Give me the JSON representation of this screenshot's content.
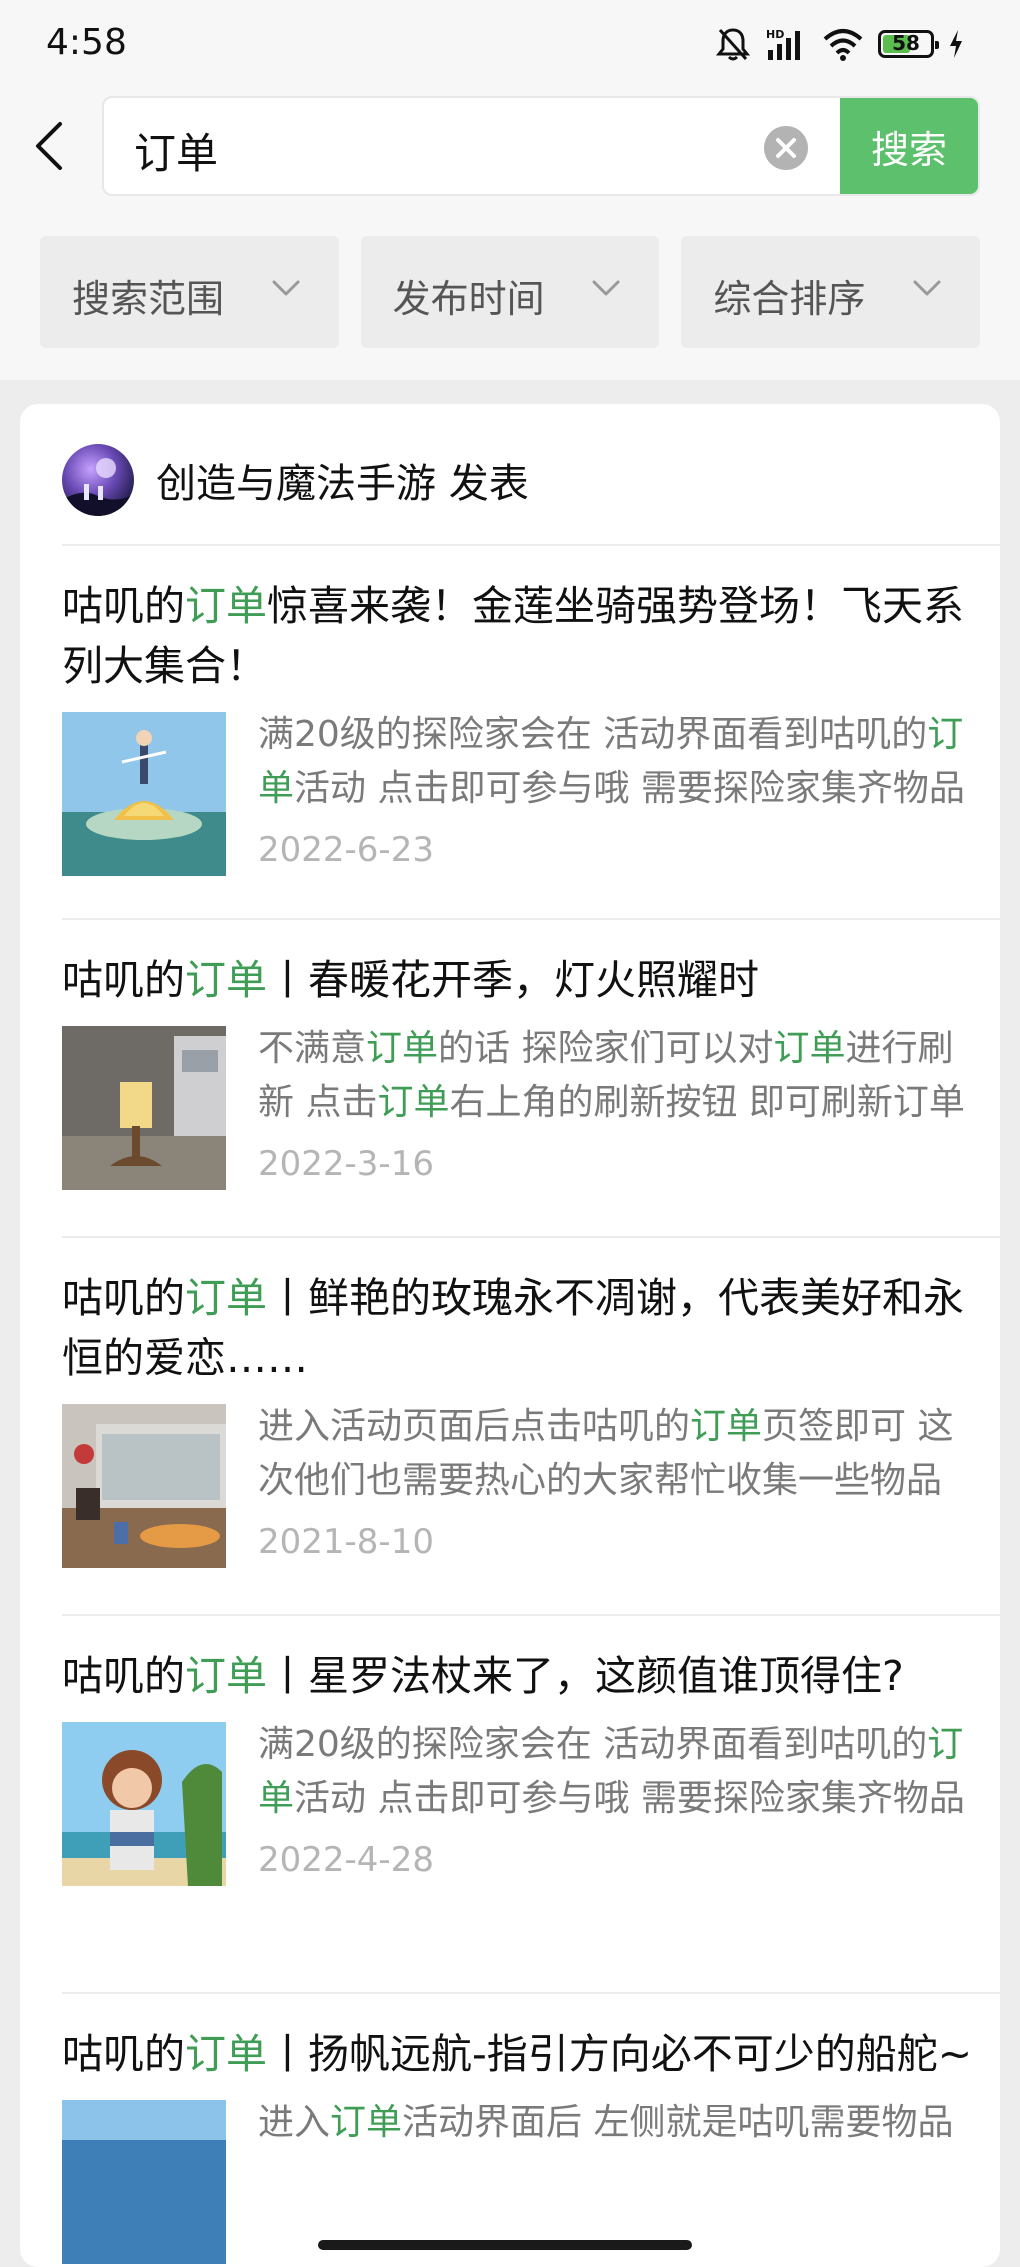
{
  "status_bar": {
    "time": "4:58",
    "battery": "58",
    "battery_level": 0.58
  },
  "search": {
    "query": "订单",
    "button_label": "搜索"
  },
  "filters": [
    {
      "label": "搜索范围"
    },
    {
      "label": "发布时间"
    },
    {
      "label": "综合排序"
    }
  ],
  "author": {
    "name": "创造与魔法手游 发表"
  },
  "results": [
    {
      "title_pre": "咕叽的",
      "title_hl": "订单",
      "title_post": "惊喜来袭！金莲坐骑强势登场！飞天系列大集合！",
      "desc": [
        {
          "t": "满20级的探险家会在 活动界面看到咕叽的"
        },
        {
          "t": "订单",
          "hl": true
        },
        {
          "t": "活动 点击即可参与哦 需要探险家集齐物品"
        }
      ],
      "date": "2022-6-23"
    },
    {
      "title_pre": "咕叽的",
      "title_hl": "订单",
      "title_post": "丨春暖花开季，灯火照耀时",
      "desc": [
        {
          "t": "不满意"
        },
        {
          "t": "订单",
          "hl": true
        },
        {
          "t": "的话 探险家们可以对"
        },
        {
          "t": "订单",
          "hl": true
        },
        {
          "t": "进行刷新 点击"
        },
        {
          "t": "订单",
          "hl": true
        },
        {
          "t": "右上角的刷新按钮 即可刷新订单"
        }
      ],
      "date": "2022-3-16"
    },
    {
      "title_pre": "咕叽的",
      "title_hl": "订单",
      "title_post": "丨鲜艳的玫瑰永不凋谢，代表美好和永恒的爱恋……",
      "desc": [
        {
          "t": "进入活动页面后点击咕叽的"
        },
        {
          "t": "订单",
          "hl": true
        },
        {
          "t": "页签即可 这次他们也需要热心的大家帮忙收集一些物品"
        }
      ],
      "date": "2021-8-10"
    },
    {
      "title_pre": "咕叽的",
      "title_hl": "订单",
      "title_post": "丨星罗法杖来了，这颜值谁顶得住?",
      "desc": [
        {
          "t": "满20级的探险家会在 活动界面看到咕叽的"
        },
        {
          "t": "订单",
          "hl": true
        },
        {
          "t": "活动 点击即可参与哦 需要探险家集齐物品"
        }
      ],
      "date": "2022-4-28"
    },
    {
      "title_pre": "咕叽的",
      "title_hl": "订单",
      "title_post": "丨扬帆远航-指引方向必不可少的船舵~",
      "desc": [
        {
          "t": "进入"
        },
        {
          "t": "订单",
          "hl": true
        },
        {
          "t": "活动界面后 左侧就是咕叽需要物品"
        }
      ],
      "date": ""
    }
  ],
  "icons": {
    "back": "back-arrow-icon",
    "clear": "clear-icon",
    "chevron": "chevron-down-icon",
    "accent": "#5cc06c",
    "highlight": "#3f9d56"
  }
}
